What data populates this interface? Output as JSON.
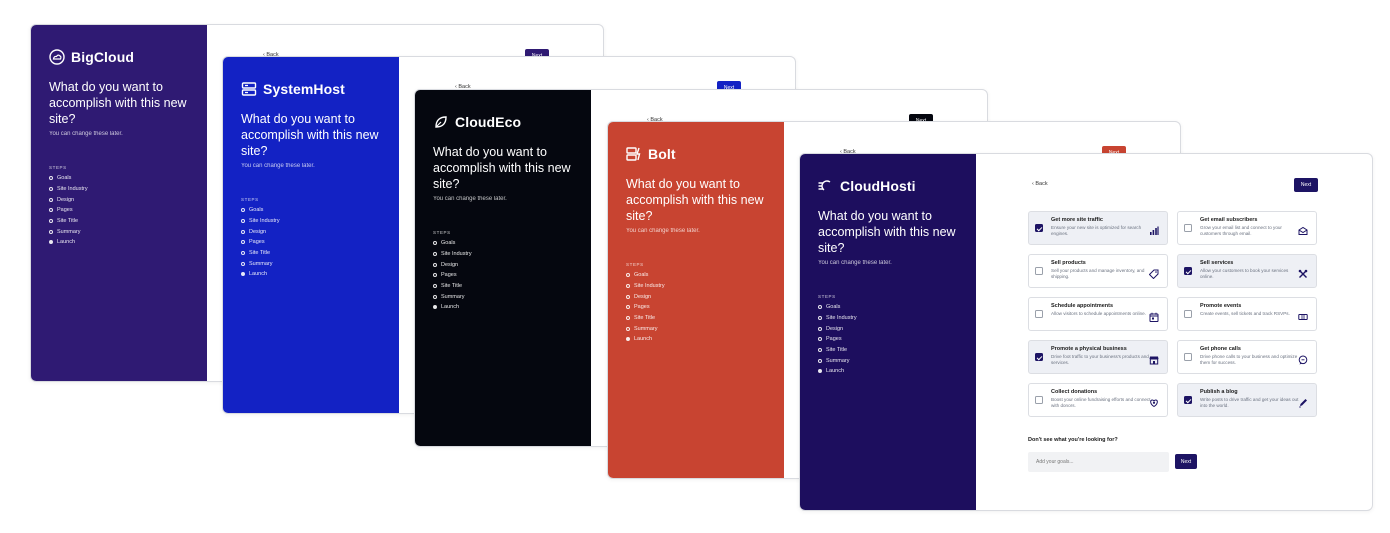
{
  "common": {
    "headline": "What do you want to accomplish with this new site?",
    "subtext": "You can change these later.",
    "steps_label": "STEPS",
    "steps": [
      "Goals",
      "Site Industry",
      "Design",
      "Pages",
      "Site Title",
      "Summary",
      "Launch"
    ],
    "active_step": "Launch",
    "back_label": "‹ Back",
    "next_label": "Next"
  },
  "cards": [
    {
      "brand": "BigCloud",
      "panel_color": "#2f1a73",
      "accent": "#2f1a73"
    },
    {
      "brand": "SystemHost",
      "panel_color": "#1322c4",
      "accent": "#1322c4"
    },
    {
      "brand": "CloudEco",
      "panel_color": "#05070f",
      "accent": "#05070f"
    },
    {
      "brand": "Bolt",
      "panel_color": "#c84431",
      "accent": "#c84431"
    },
    {
      "brand": "CloudHosti",
      "panel_color": "#1d0e5e",
      "accent": "#1d1464"
    }
  ],
  "goals": [
    {
      "title": "Get more site traffic",
      "desc": "Ensure your new site is optimized for search engines.",
      "selected": true,
      "icon": "chart-bars-icon"
    },
    {
      "title": "Get email subscribers",
      "desc": "Grow your email list and connect to your customers through email.",
      "selected": false,
      "icon": "envelope-icon"
    },
    {
      "title": "Sell products",
      "desc": "Sell your products and manage inventory, and shipping.",
      "selected": false,
      "icon": "tag-icon"
    },
    {
      "title": "Sell services",
      "desc": "Allow your customers to book your services online.",
      "selected": true,
      "icon": "tools-icon"
    },
    {
      "title": "Schedule appointments",
      "desc": "Allow visitors to schedule appointments online.",
      "selected": false,
      "icon": "calendar-icon"
    },
    {
      "title": "Promote events",
      "desc": "Create events, sell tickets and track RSVPs.",
      "selected": false,
      "icon": "ticket-icon"
    },
    {
      "title": "Promote a physical business",
      "desc": "Drive foot traffic to your business's products and services.",
      "selected": true,
      "icon": "store-icon"
    },
    {
      "title": "Get phone calls",
      "desc": "Drive phone calls to your business and optimize them for success.",
      "selected": false,
      "icon": "chat-bubble-icon"
    },
    {
      "title": "Collect donations",
      "desc": "Boost your online fundraising efforts and connect with donors.",
      "selected": false,
      "icon": "hand-heart-icon"
    },
    {
      "title": "Publish a blog",
      "desc": "Write posts to drive traffic and get your ideas out into the world.",
      "selected": true,
      "icon": "pencil-icon"
    }
  ],
  "footer": {
    "question": "Don't see what you're looking for?",
    "input_placeholder": "Add your goals...",
    "next_label": "Next"
  }
}
